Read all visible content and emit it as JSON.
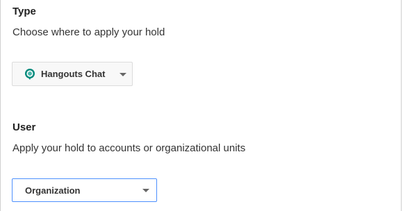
{
  "type_section": {
    "heading": "Type",
    "description": "Choose where to apply your hold",
    "dropdown": {
      "selected": "Hangouts Chat",
      "icon": "hangouts-chat-icon",
      "icon_color": "#00897b"
    }
  },
  "user_section": {
    "heading": "User",
    "description": "Apply your hold to accounts or organizational units",
    "dropdown": {
      "selected": "Organization",
      "focus_color": "#4d90fe"
    }
  }
}
